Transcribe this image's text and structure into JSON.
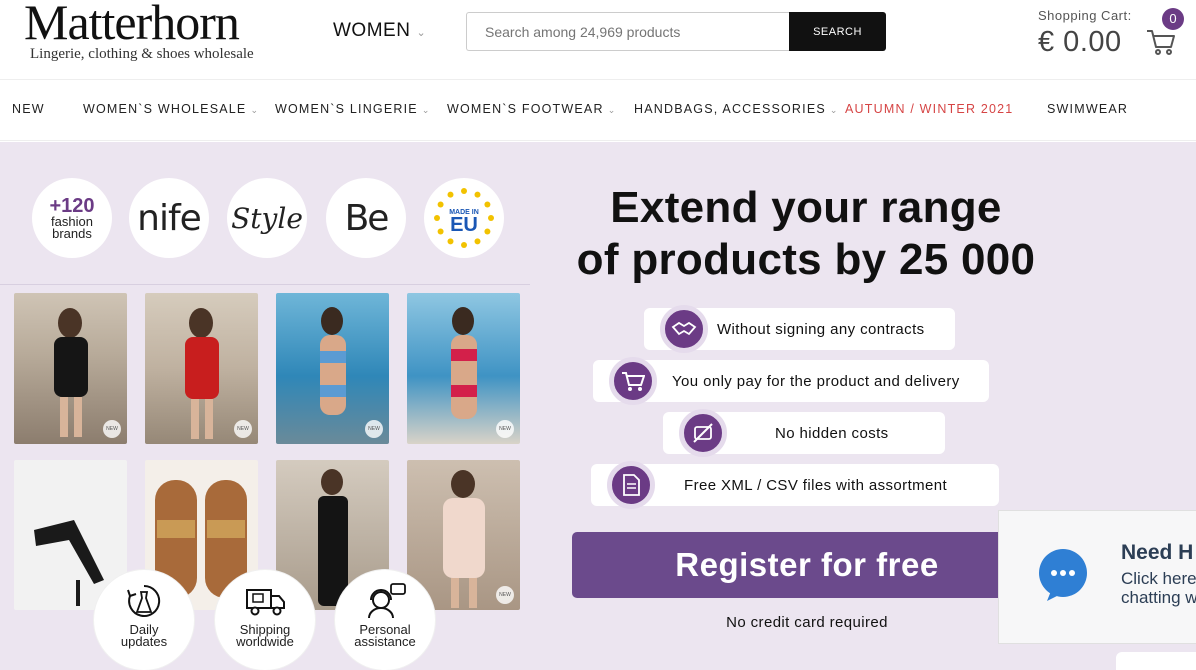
{
  "logo": {
    "title": "Matterhorn",
    "subtitle": "Lingerie, clothing & shoes wholesale"
  },
  "header": {
    "women_menu": "WOMEN",
    "search": {
      "placeholder": "Search among 24,969 products",
      "button": "SEARCH"
    },
    "cart": {
      "label": "Shopping Cart:",
      "total": "€ 0.00",
      "count": "0"
    }
  },
  "nav": [
    {
      "label": "NEW",
      "dropdown": false
    },
    {
      "label": "WOMEN`S WHOLESALE",
      "dropdown": true
    },
    {
      "label": "WOMEN`S LINGERIE",
      "dropdown": true
    },
    {
      "label": "WOMEN`S FOOTWEAR",
      "dropdown": true
    },
    {
      "label": "HANDBAGS, ACCESSORIES",
      "dropdown": true
    },
    {
      "label": "AUTUMN / WINTER 2021",
      "dropdown": false
    },
    {
      "label": "SWIMWEAR",
      "dropdown": false
    }
  ],
  "brands": {
    "count_big": "+120",
    "count_small_1": "fashion",
    "count_small_2": "brands",
    "b1": "nife",
    "b2": "Style",
    "b3": "Be",
    "eu": "MADE IN",
    "eu_big": "EU"
  },
  "features_bottom": [
    {
      "line1": "Daily",
      "line2": "updates",
      "icon": "dress-refresh-icon"
    },
    {
      "line1": "Shipping",
      "line2": "worldwide",
      "icon": "truck-icon"
    },
    {
      "line1": "Personal",
      "line2": "assistance",
      "icon": "support-agent-icon"
    }
  ],
  "hero": {
    "headline_1": "Extend your range",
    "headline_2": "of products by 25 000",
    "benefits": [
      {
        "text": "Without signing any contracts",
        "icon": "handshake-icon"
      },
      {
        "text": "You only pay for the product and delivery",
        "icon": "shopping-cart-icon"
      },
      {
        "text": "No hidden costs",
        "icon": "no-cost-icon"
      },
      {
        "text": "Free XML / CSV files with assortment",
        "icon": "document-icon"
      }
    ],
    "register": "Register for free",
    "no_card": "No credit card required"
  },
  "chat": {
    "title": "Need H",
    "sub_1": "Click here",
    "sub_2": "chatting w"
  },
  "colors": {
    "accent": "#6b3b85",
    "hero_bg": "#ece5f0",
    "red_nav": "#d64545",
    "chat_text": "#2c3e55"
  }
}
